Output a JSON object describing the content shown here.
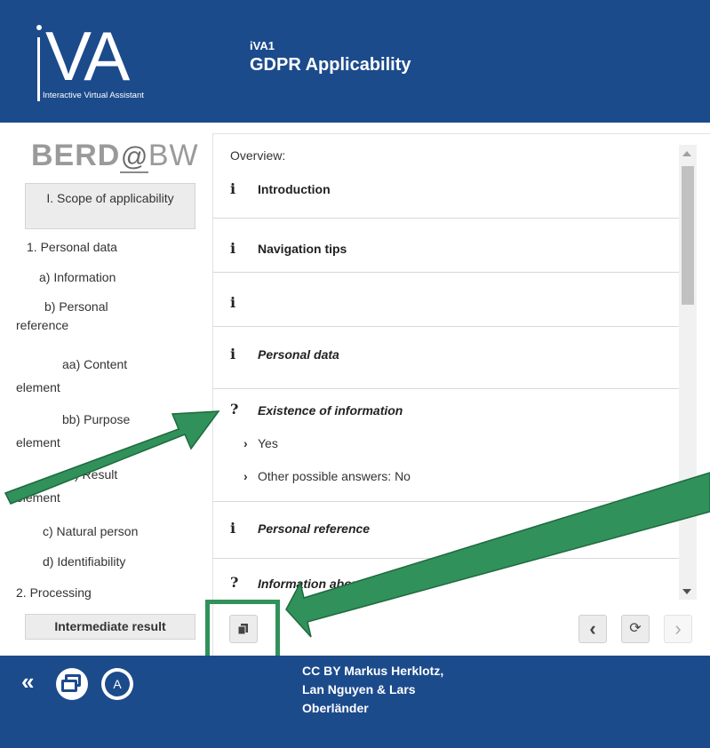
{
  "header": {
    "logo_text": "iVA",
    "logo_subtitle": "Interactive Virtual Assistant",
    "app_small": "iVA1",
    "app_title": "GDPR Applicability"
  },
  "sidebar": {
    "brand": {
      "left": "BERD",
      "at": "@",
      "right": "BW"
    },
    "scope_label": "I. Scope of applicability",
    "items": [
      {
        "label": "1. Personal data"
      },
      {
        "label": "a) Information"
      },
      {
        "label": "b) Personal"
      },
      {
        "label": "reference"
      },
      {
        "label": "aa) Content"
      },
      {
        "label": "element"
      },
      {
        "label": "bb) Purpose"
      },
      {
        "label": "element"
      },
      {
        "label": "cc) Result"
      },
      {
        "label": "element"
      },
      {
        "label": "c) Natural person"
      },
      {
        "label": "d) Identifiability"
      },
      {
        "label": "2. Processing"
      }
    ],
    "intermediate_label": "Intermediate result"
  },
  "main": {
    "overview_label": "Overview:",
    "rows": [
      {
        "icon": "i",
        "label": "Introduction"
      },
      {
        "icon": "i",
        "label": "Navigation tips"
      },
      {
        "icon": "i",
        "label": ""
      },
      {
        "icon": "i",
        "label": "Personal data"
      },
      {
        "icon": "?",
        "label": "Existence of information"
      },
      {
        "icon": "i",
        "label": "Personal reference"
      },
      {
        "icon": "?",
        "label": "Information about a person"
      }
    ],
    "answers": [
      {
        "label": "Yes"
      },
      {
        "label": "Other possible answers: No"
      }
    ]
  },
  "buttons": {
    "copy": "copy-icon",
    "back": "‹",
    "reload": "⟳",
    "forward": "›"
  },
  "footer": {
    "collapse": "«",
    "a_label": "A",
    "credits": "CC BY Markus Herklotz, Lan Nguyen & Lars Oberländer"
  },
  "colors": {
    "brand_blue": "#1c4b8c",
    "highlight_green": "#31915a"
  }
}
